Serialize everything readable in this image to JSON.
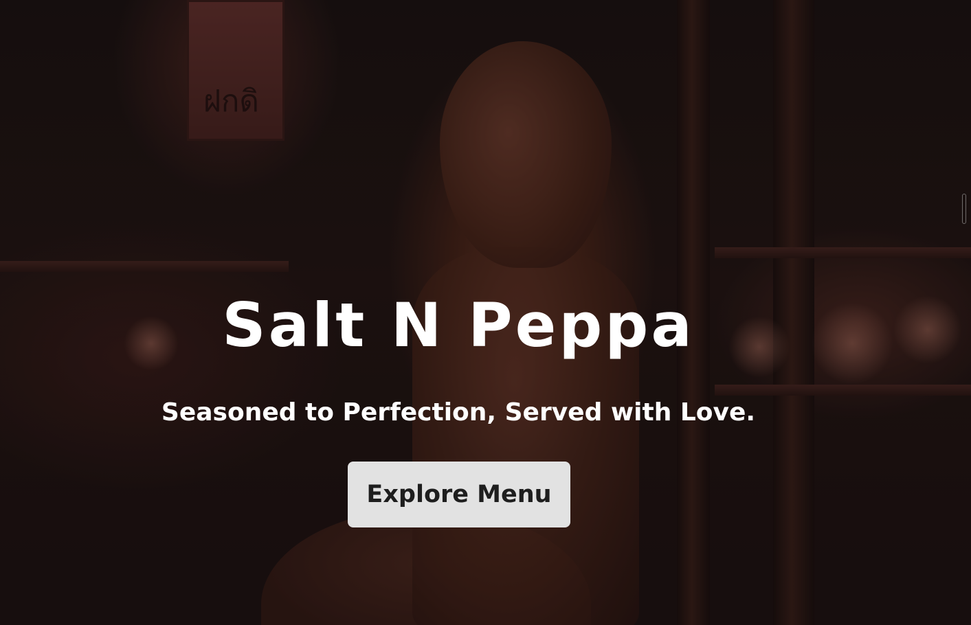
{
  "hero": {
    "title": "Salt N Peppa",
    "tagline": "Seasoned to Perfection, Served with Love.",
    "cta_label": "Explore Menu",
    "background_image": "restaurant-interior-buddha-statue",
    "overlay_color": "#0f0808"
  },
  "colors": {
    "title_text": "#ffffff",
    "button_background": "#e2e2e2",
    "button_text": "#1e1e1e"
  }
}
